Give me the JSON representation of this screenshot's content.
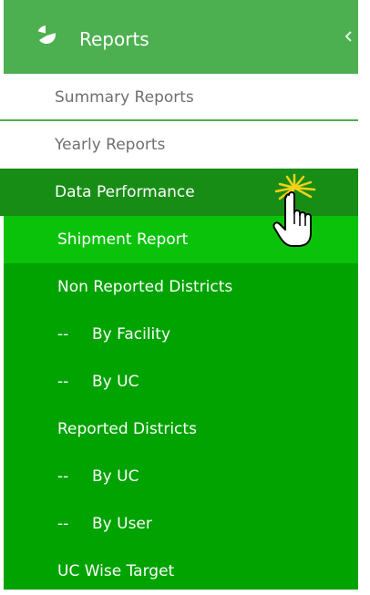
{
  "header": {
    "title": "Reports",
    "icon": "pie-chart-icon",
    "collapse_icon": "chevron-left-icon"
  },
  "menu": {
    "summary_reports": "Summary Reports",
    "yearly_reports": "Yearly Reports",
    "data_performance": "Data Performance"
  },
  "submenu": {
    "shipment_report": "Shipment Report",
    "non_reported_districts": "Non Reported Districts",
    "by_facility_prefix": "--",
    "by_facility": "By Facility",
    "by_uc_1_prefix": "--",
    "by_uc_1": "By UC",
    "reported_districts": "Reported Districts",
    "by_uc_2_prefix": "--",
    "by_uc_2": "By UC",
    "by_user_prefix": "--",
    "by_user": "By User",
    "uc_wise_target": "UC Wise Target"
  },
  "colors": {
    "header_green": "#4cb050",
    "active_green": "#188d15",
    "submenu_green": "#00a300",
    "hover_green": "#0ac20a"
  }
}
